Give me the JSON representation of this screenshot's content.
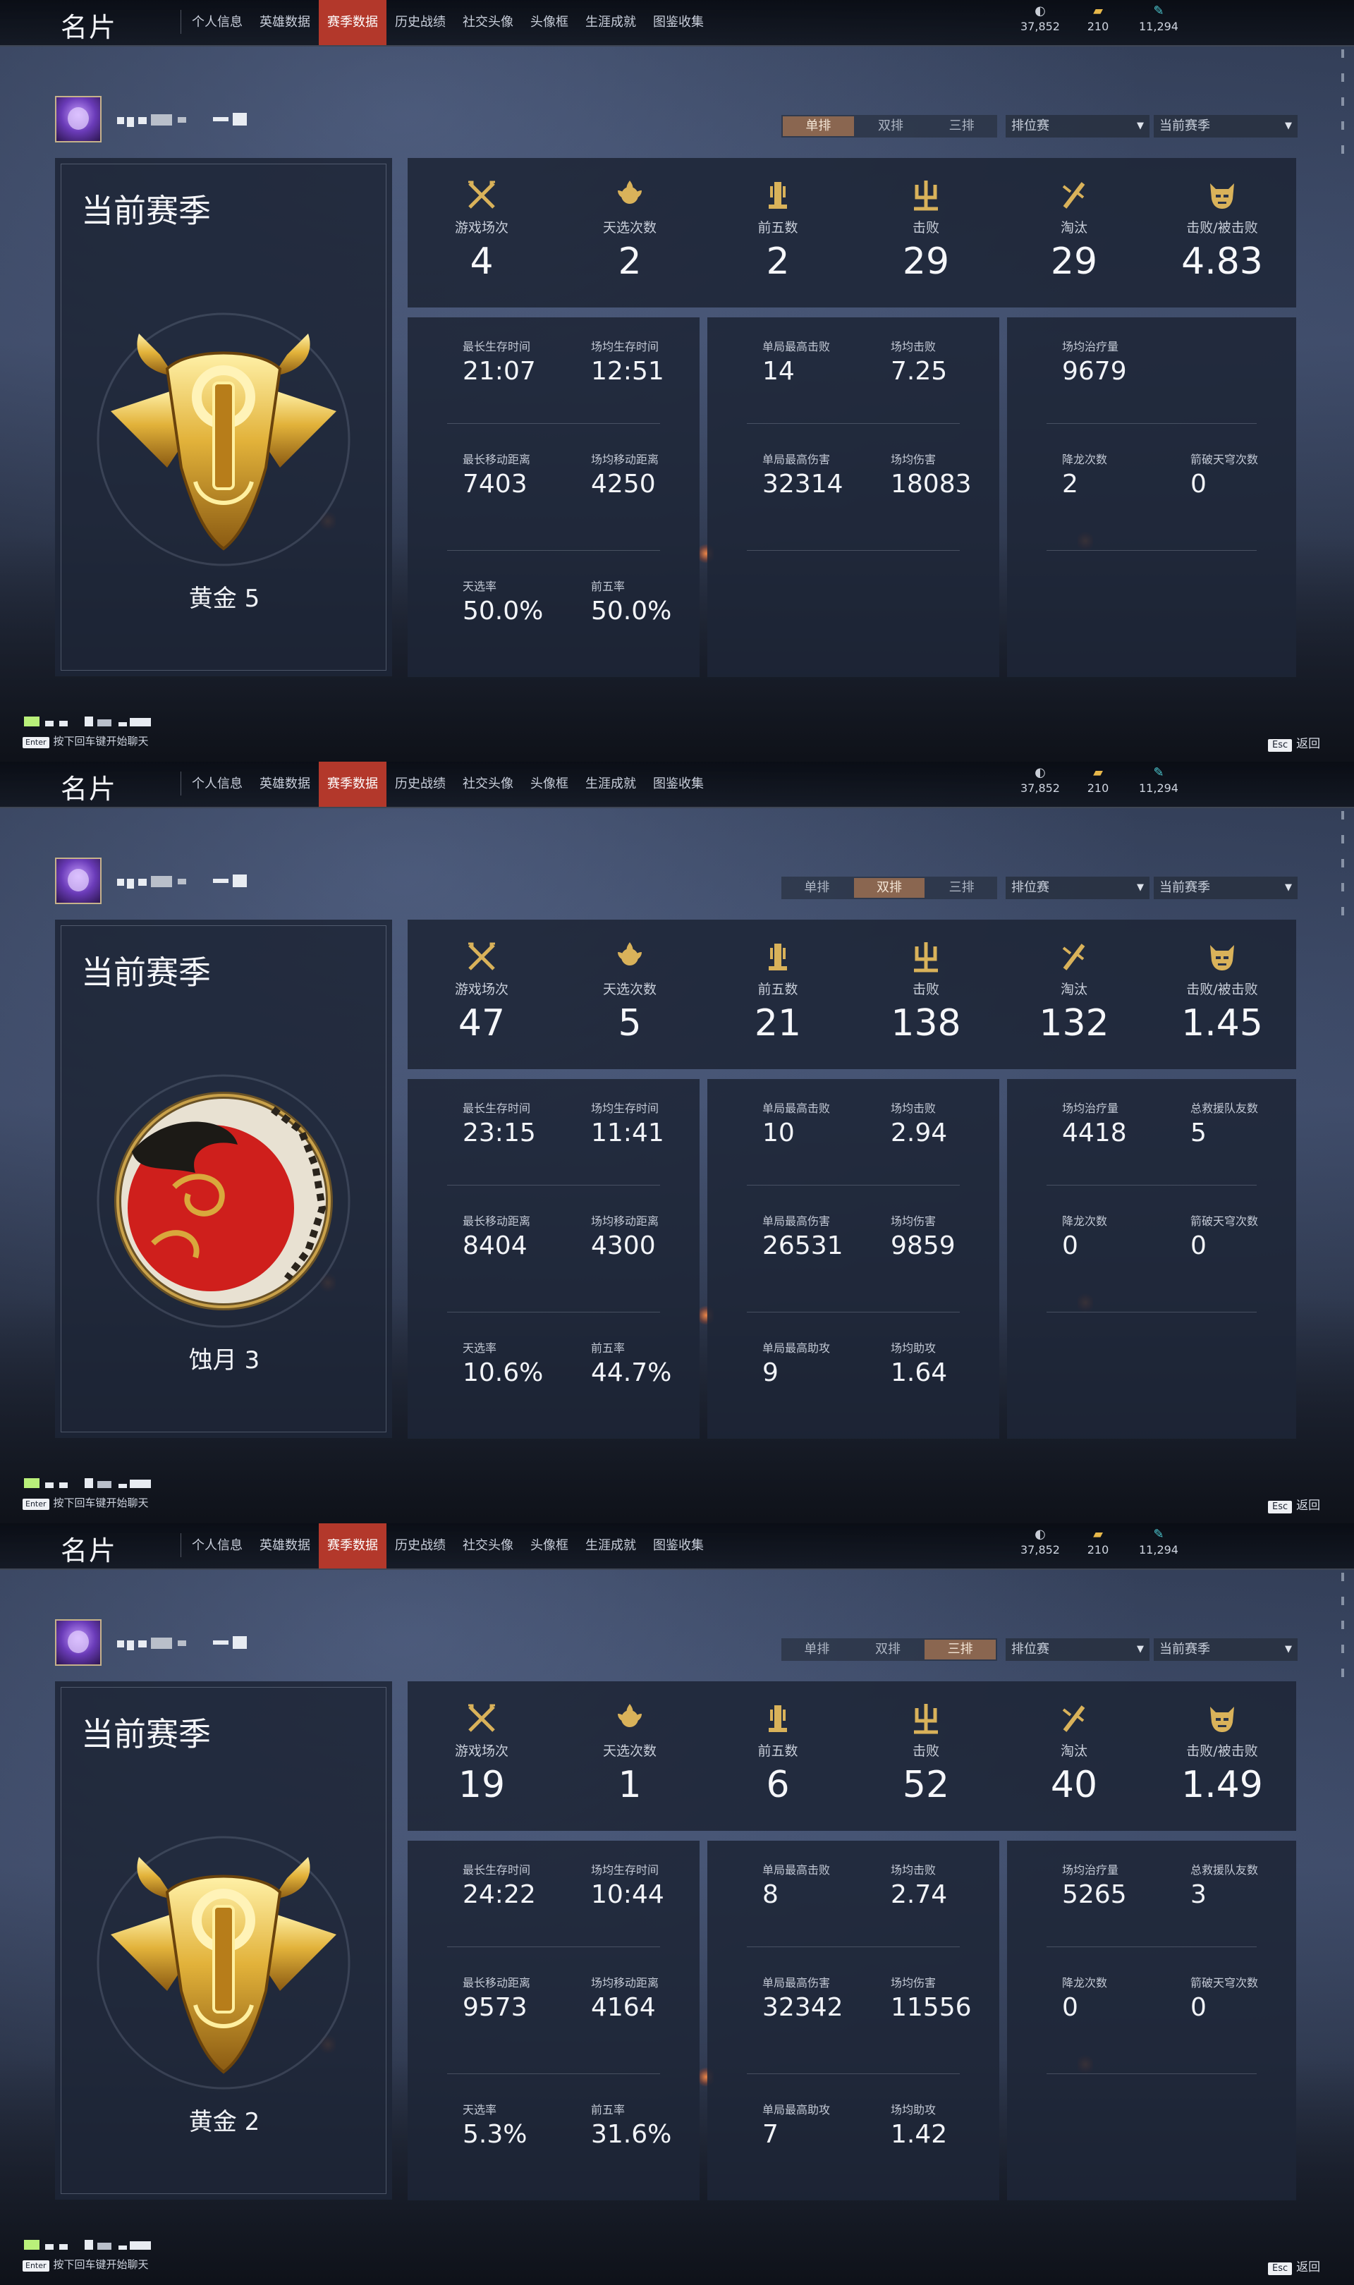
{
  "topbar": {
    "title": "名片",
    "tabs": [
      {
        "label": "个人信息"
      },
      {
        "label": "英雄数据"
      },
      {
        "label": "赛季数据",
        "active": true
      },
      {
        "label": "历史战绩"
      },
      {
        "label": "社交头像",
        "has_dot": true
      },
      {
        "label": "头像框"
      },
      {
        "label": "生涯成就"
      },
      {
        "label": "图鉴收集"
      }
    ],
    "currencies": [
      {
        "icon": "coin-icon",
        "value": "37,852"
      },
      {
        "icon": "gold-ticket-icon",
        "value": "210"
      },
      {
        "icon": "feather-icon",
        "value": "11,294"
      }
    ]
  },
  "mode_tabs": [
    "单排",
    "双排",
    "三排"
  ],
  "filters": {
    "match_type": "排位赛",
    "season": "当前赛季"
  },
  "season_title": "当前赛季",
  "summary_labels": [
    "游戏场次",
    "天选次数",
    "前五数",
    "击败",
    "淘汰",
    "击败/被击败"
  ],
  "footer": {
    "enter_key": "Enter",
    "enter_hint": "按下回车键开始聊天",
    "esc_key": "Esc",
    "esc_label": "返回"
  },
  "panels": [
    {
      "active_mode": 0,
      "rank": "黄金 5",
      "medal": "gold",
      "summary": [
        "4",
        "2",
        "2",
        "29",
        "29",
        "4.83"
      ],
      "survival": [
        {
          "label": "最长生存时间",
          "value": "21:07"
        },
        {
          "label": "场均生存时间",
          "value": "12:51"
        },
        {
          "label": "最长移动距离",
          "value": "7403"
        },
        {
          "label": "场均移动距离",
          "value": "4250"
        },
        {
          "label": "天选率",
          "value": "50.0%"
        },
        {
          "label": "前五率",
          "value": "50.0%"
        }
      ],
      "combat": [
        {
          "label": "单局最高击败",
          "value": "14"
        },
        {
          "label": "场均击败",
          "value": "7.25"
        },
        {
          "label": "单局最高伤害",
          "value": "32314"
        },
        {
          "label": "场均伤害",
          "value": "18083"
        }
      ],
      "support": [
        {
          "label": "场均治疗量",
          "value": "9679"
        },
        {
          "label": "",
          "value": ""
        },
        {
          "label": "降龙次数",
          "value": "2"
        },
        {
          "label": "箭破天穹次数",
          "value": "0"
        }
      ]
    },
    {
      "active_mode": 1,
      "rank": "蚀月 3",
      "medal": "moon",
      "summary": [
        "47",
        "5",
        "21",
        "138",
        "132",
        "1.45"
      ],
      "survival": [
        {
          "label": "最长生存时间",
          "value": "23:15"
        },
        {
          "label": "场均生存时间",
          "value": "11:41"
        },
        {
          "label": "最长移动距离",
          "value": "8404"
        },
        {
          "label": "场均移动距离",
          "value": "4300"
        },
        {
          "label": "天选率",
          "value": "10.6%"
        },
        {
          "label": "前五率",
          "value": "44.7%"
        }
      ],
      "combat": [
        {
          "label": "单局最高击败",
          "value": "10"
        },
        {
          "label": "场均击败",
          "value": "2.94"
        },
        {
          "label": "单局最高伤害",
          "value": "26531"
        },
        {
          "label": "场均伤害",
          "value": "9859"
        },
        {
          "label": "单局最高助攻",
          "value": "9"
        },
        {
          "label": "场均助攻",
          "value": "1.64"
        }
      ],
      "support": [
        {
          "label": "场均治疗量",
          "value": "4418"
        },
        {
          "label": "总救援队友数",
          "value": "5"
        },
        {
          "label": "降龙次数",
          "value": "0"
        },
        {
          "label": "箭破天穹次数",
          "value": "0"
        }
      ]
    },
    {
      "active_mode": 2,
      "rank": "黄金 2",
      "medal": "gold",
      "summary": [
        "19",
        "1",
        "6",
        "52",
        "40",
        "1.49"
      ],
      "survival": [
        {
          "label": "最长生存时间",
          "value": "24:22"
        },
        {
          "label": "场均生存时间",
          "value": "10:44"
        },
        {
          "label": "最长移动距离",
          "value": "9573"
        },
        {
          "label": "场均移动距离",
          "value": "4164"
        },
        {
          "label": "天选率",
          "value": "5.3%"
        },
        {
          "label": "前五率",
          "value": "31.6%"
        }
      ],
      "combat": [
        {
          "label": "单局最高击败",
          "value": "8"
        },
        {
          "label": "场均击败",
          "value": "2.74"
        },
        {
          "label": "单局最高伤害",
          "value": "32342"
        },
        {
          "label": "场均伤害",
          "value": "11556"
        },
        {
          "label": "单局最高助攻",
          "value": "7"
        },
        {
          "label": "场均助攻",
          "value": "1.42"
        }
      ],
      "support": [
        {
          "label": "场均治疗量",
          "value": "5265"
        },
        {
          "label": "总救援队友数",
          "value": "3"
        },
        {
          "label": "降龙次数",
          "value": "0"
        },
        {
          "label": "箭破天穹次数",
          "value": "0"
        }
      ]
    }
  ]
}
